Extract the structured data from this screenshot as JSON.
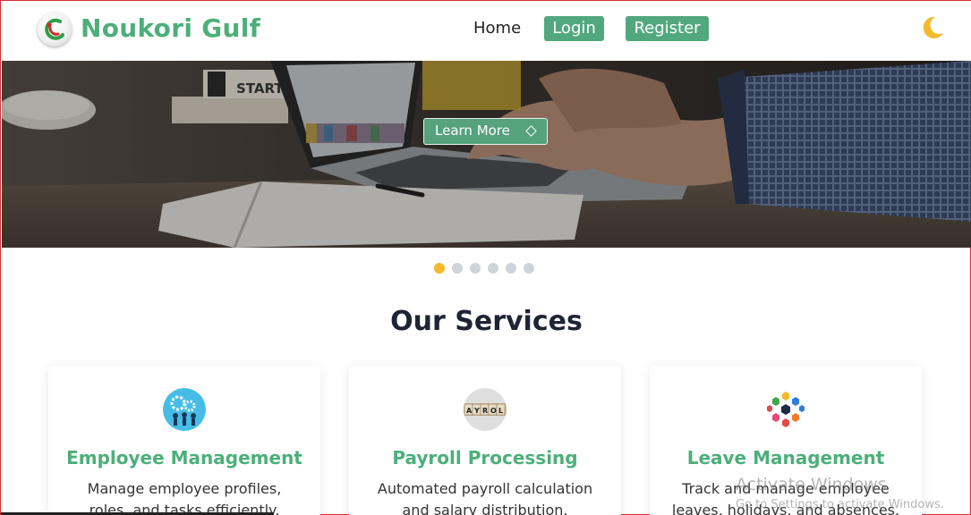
{
  "header": {
    "brand": "Noukori Gulf",
    "nav": {
      "home": "Home",
      "login": "Login",
      "register": "Register"
    },
    "theme_toggle_icon": "moon-icon"
  },
  "hero": {
    "learn_more_label": "Learn More",
    "learn_more_icon": "diamond-icon",
    "carousel": {
      "slide_count": 6,
      "active_index": 0,
      "active_color": "#f5b92b",
      "inactive_color": "#cfd3da"
    }
  },
  "services": {
    "title": "Our Services",
    "cards": [
      {
        "title": "Employee Management",
        "description": "Manage employee profiles, roles, and tasks efficiently.",
        "icon": "team-gears-icon"
      },
      {
        "title": "Payroll Processing",
        "description": "Automated payroll calculation and salary distribution.",
        "icon": "payroll-blocks-icon"
      },
      {
        "title": "Leave Management",
        "description": "Track and manage employee leaves, holidays, and absences.",
        "icon": "hexagon-network-icon"
      }
    ]
  },
  "os_overlay": {
    "watermark_title": "Activate Windows",
    "watermark_subtitle": "Go to Settings to activate Windows."
  },
  "colors": {
    "brand_green": "#4caf7a",
    "button_green": "#52a87e",
    "moon_yellow": "#f5b92b",
    "heading_dark": "#1f2433"
  }
}
